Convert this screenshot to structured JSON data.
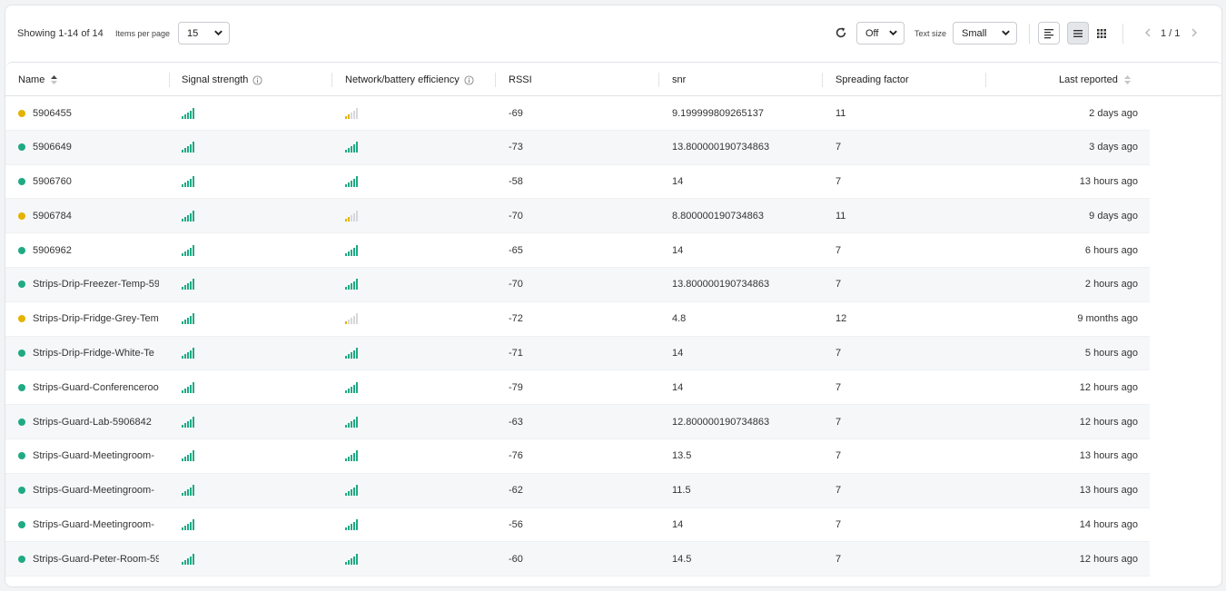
{
  "toolbar": {
    "showing": "Showing 1-14 of 14",
    "items_per_page_label": "Items per page",
    "items_per_page_value": "15",
    "refresh_value": "Off",
    "text_size_label": "Text size",
    "text_size_value": "Small",
    "pagination": "1 / 1"
  },
  "columns": {
    "name": "Name",
    "signal": "Signal strength",
    "efficiency": "Network/battery efficiency",
    "rssi": "RSSI",
    "snr": "snr",
    "sf": "Spreading factor",
    "last": "Last reported"
  },
  "colors": {
    "green": "#1faa84",
    "yellow": "#e3b300",
    "grey_bar": "#d6d8db"
  },
  "rows": [
    {
      "name": "5906455",
      "status": "yellow",
      "signal": 5,
      "efficiency": 2,
      "eff_color": "yellow",
      "rssi": "-69",
      "snr": "9.199999809265137",
      "sf": "11",
      "last": "2 days ago"
    },
    {
      "name": "5906649",
      "status": "green",
      "signal": 5,
      "efficiency": 5,
      "eff_color": "green",
      "rssi": "-73",
      "snr": "13.800000190734863",
      "sf": "7",
      "last": "3 days ago"
    },
    {
      "name": "5906760",
      "status": "green",
      "signal": 5,
      "efficiency": 5,
      "eff_color": "green",
      "rssi": "-58",
      "snr": "14",
      "sf": "7",
      "last": "13 hours ago"
    },
    {
      "name": "5906784",
      "status": "yellow",
      "signal": 5,
      "efficiency": 2,
      "eff_color": "yellow",
      "rssi": "-70",
      "snr": "8.800000190734863",
      "sf": "11",
      "last": "9 days ago"
    },
    {
      "name": "5906962",
      "status": "green",
      "signal": 5,
      "efficiency": 5,
      "eff_color": "green",
      "rssi": "-65",
      "snr": "14",
      "sf": "7",
      "last": "6 hours ago"
    },
    {
      "name": "Strips-Drip-Freezer-Temp-59",
      "status": "green",
      "signal": 5,
      "efficiency": 5,
      "eff_color": "green",
      "rssi": "-70",
      "snr": "13.800000190734863",
      "sf": "7",
      "last": "2 hours ago"
    },
    {
      "name": "Strips-Drip-Fridge-Grey-Tem",
      "status": "yellow",
      "signal": 5,
      "efficiency": 1,
      "eff_color": "yellow",
      "rssi": "-72",
      "snr": "4.8",
      "sf": "12",
      "last": "9 months ago"
    },
    {
      "name": "Strips-Drip-Fridge-White-Te",
      "status": "green",
      "signal": 5,
      "efficiency": 5,
      "eff_color": "green",
      "rssi": "-71",
      "snr": "14",
      "sf": "7",
      "last": "5 hours ago"
    },
    {
      "name": "Strips-Guard-Conferenceroo",
      "status": "green",
      "signal": 5,
      "efficiency": 5,
      "eff_color": "green",
      "rssi": "-79",
      "snr": "14",
      "sf": "7",
      "last": "12 hours ago"
    },
    {
      "name": "Strips-Guard-Lab-5906842",
      "status": "green",
      "signal": 5,
      "efficiency": 5,
      "eff_color": "green",
      "rssi": "-63",
      "snr": "12.800000190734863",
      "sf": "7",
      "last": "12 hours ago"
    },
    {
      "name": "Strips-Guard-Meetingroom-",
      "status": "green",
      "signal": 5,
      "efficiency": 5,
      "eff_color": "green",
      "rssi": "-76",
      "snr": "13.5",
      "sf": "7",
      "last": "13 hours ago"
    },
    {
      "name": "Strips-Guard-Meetingroom-",
      "status": "green",
      "signal": 5,
      "efficiency": 5,
      "eff_color": "green",
      "rssi": "-62",
      "snr": "11.5",
      "sf": "7",
      "last": "13 hours ago"
    },
    {
      "name": "Strips-Guard-Meetingroom-",
      "status": "green",
      "signal": 5,
      "efficiency": 5,
      "eff_color": "green",
      "rssi": "-56",
      "snr": "14",
      "sf": "7",
      "last": "14 hours ago"
    },
    {
      "name": "Strips-Guard-Peter-Room-59",
      "status": "green",
      "signal": 5,
      "efficiency": 5,
      "eff_color": "green",
      "rssi": "-60",
      "snr": "14.5",
      "sf": "7",
      "last": "12 hours ago"
    }
  ]
}
